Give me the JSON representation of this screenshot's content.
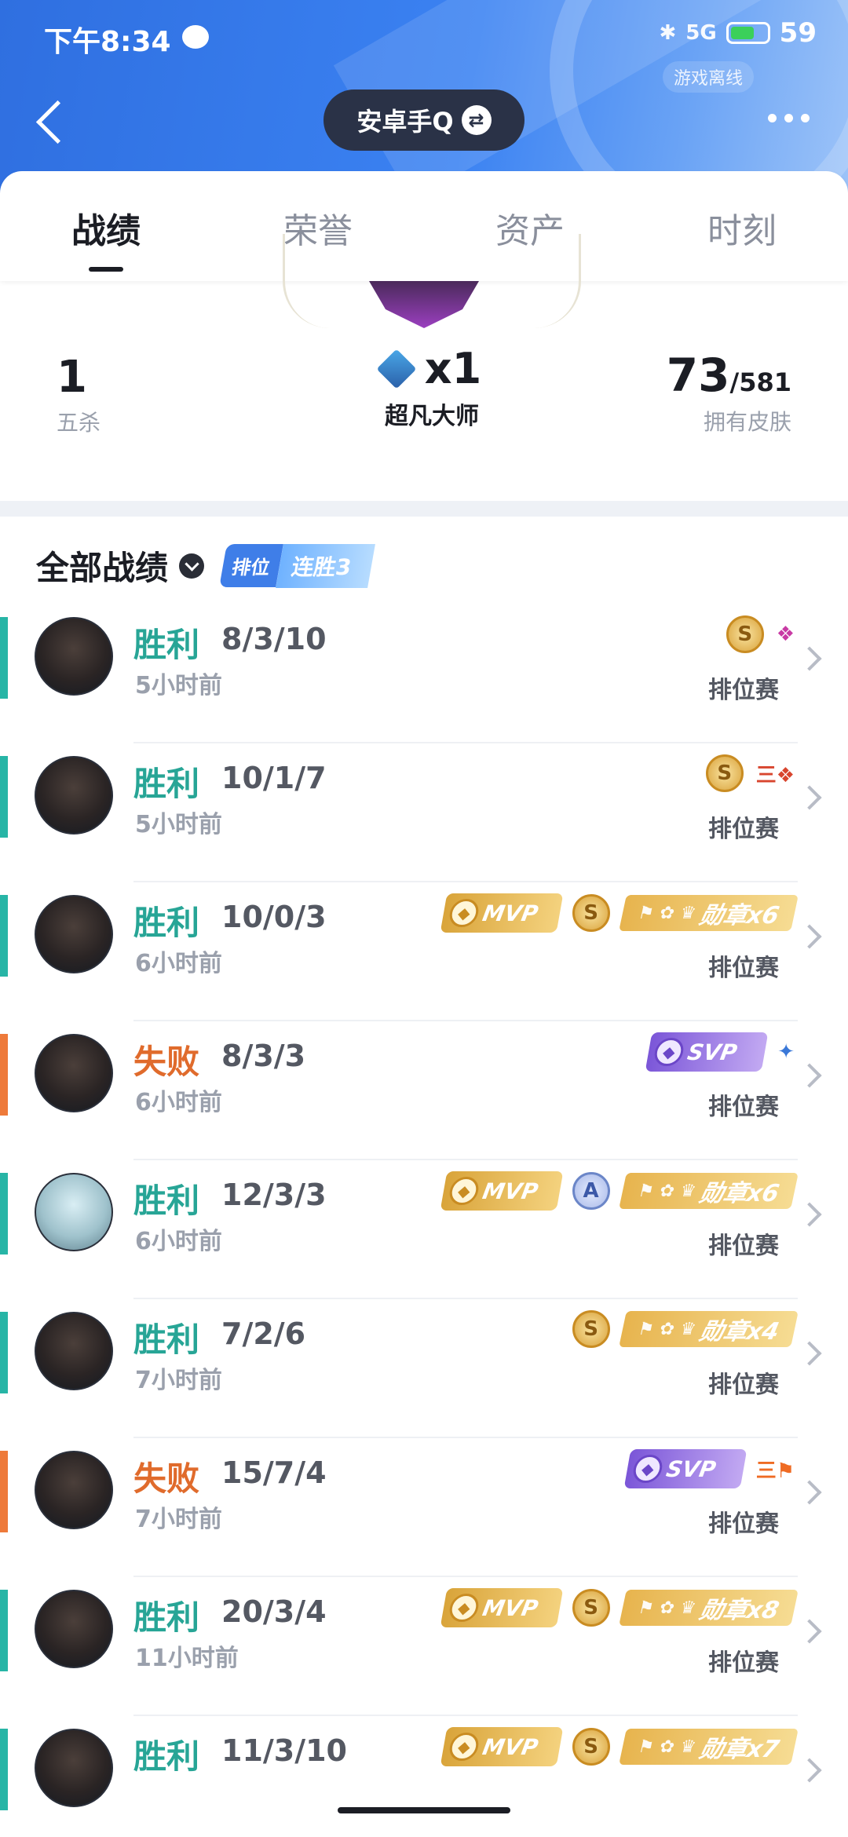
{
  "status_bar": {
    "time": "下午8:34",
    "battery": "59",
    "network": "5G",
    "offline_label": "游戏离线"
  },
  "header": {
    "account_name": "安卓手Q"
  },
  "tabs": [
    {
      "label": "战绩",
      "active": true
    },
    {
      "label": "荣誉",
      "active": false
    },
    {
      "label": "资产",
      "active": false
    },
    {
      "label": "时刻",
      "active": false
    }
  ],
  "summary": {
    "penta": {
      "value": "1",
      "label": "五杀"
    },
    "rank": {
      "value": "x1",
      "label": "超凡大师"
    },
    "skins": {
      "value": "73",
      "total": "/581",
      "label": "拥有皮肤"
    }
  },
  "records_header": {
    "title": "全部战绩",
    "streak_tag": "排位",
    "streak_text": "连胜3"
  },
  "records": [
    {
      "result": "胜利",
      "outcome": "win",
      "kda": "8/3/10",
      "ago": "5小时前",
      "mode": "排位赛",
      "mvp": false,
      "svp": false,
      "grade": "S",
      "medal": "",
      "extra": "❖",
      "extra_color": "pink",
      "avatar": "dark"
    },
    {
      "result": "胜利",
      "outcome": "win",
      "kda": "10/1/7",
      "ago": "5小时前",
      "mode": "排位赛",
      "mvp": false,
      "svp": false,
      "grade": "S",
      "medal": "",
      "extra": "三❖",
      "extra_color": "red",
      "avatar": "dark"
    },
    {
      "result": "胜利",
      "outcome": "win",
      "kda": "10/0/3",
      "ago": "6小时前",
      "mode": "排位赛",
      "mvp": true,
      "svp": false,
      "grade": "S",
      "medal": "勋章x6",
      "extra": "",
      "extra_color": "",
      "avatar": "dark"
    },
    {
      "result": "失败",
      "outcome": "loss",
      "kda": "8/3/3",
      "ago": "6小时前",
      "mode": "排位赛",
      "mvp": false,
      "svp": true,
      "grade": "",
      "medal": "",
      "extra": "✦",
      "extra_color": "blue",
      "avatar": "dark"
    },
    {
      "result": "胜利",
      "outcome": "win",
      "kda": "12/3/3",
      "ago": "6小时前",
      "mode": "排位赛",
      "mvp": true,
      "svp": false,
      "grade": "A",
      "medal": "勋章x6",
      "extra": "",
      "extra_color": "",
      "avatar": "alt"
    },
    {
      "result": "胜利",
      "outcome": "win",
      "kda": "7/2/6",
      "ago": "7小时前",
      "mode": "排位赛",
      "mvp": false,
      "svp": false,
      "grade": "S",
      "medal": "勋章x4",
      "extra": "",
      "extra_color": "",
      "avatar": "dark"
    },
    {
      "result": "失败",
      "outcome": "loss",
      "kda": "15/7/4",
      "ago": "7小时前",
      "mode": "排位赛",
      "mvp": false,
      "svp": true,
      "grade": "",
      "medal": "",
      "extra": "三⚑",
      "extra_color": "orange",
      "avatar": "dark"
    },
    {
      "result": "胜利",
      "outcome": "win",
      "kda": "20/3/4",
      "ago": "11小时前",
      "mode": "排位赛",
      "mvp": true,
      "svp": false,
      "grade": "S",
      "medal": "勋章x8",
      "extra": "",
      "extra_color": "",
      "avatar": "dark"
    },
    {
      "result": "胜利",
      "outcome": "win",
      "kda": "11/3/10",
      "ago": "",
      "mode": "",
      "mvp": true,
      "svp": false,
      "grade": "S",
      "medal": "勋章x7",
      "extra": "",
      "extra_color": "",
      "avatar": "dark"
    }
  ],
  "labels": {
    "mvp": "MVP",
    "svp": "SVP"
  },
  "colors": {
    "win": "#27b5a6",
    "loss": "#ee7a3a",
    "header_blue": "#3b82f2"
  }
}
